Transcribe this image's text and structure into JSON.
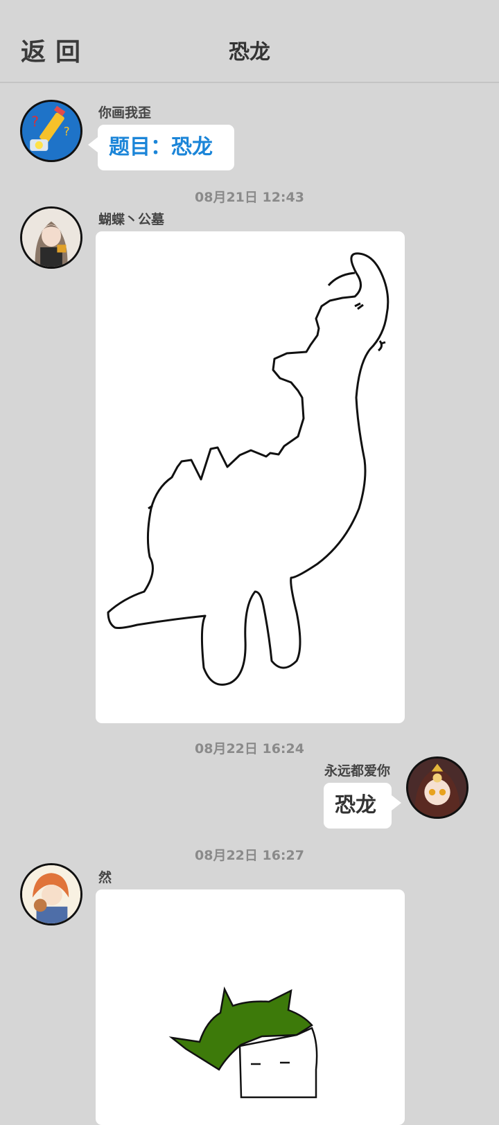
{
  "header": {
    "back_label": "返回",
    "title": "恐龙"
  },
  "messages": [
    {
      "sender": "你画我歪",
      "text": "题目：恐龙",
      "text_color": "#1b85d8"
    },
    {
      "time": "08月21日  12:43",
      "sender": "蝴蝶丶公墓",
      "content": "drawing-dinosaur"
    },
    {
      "time": "08月22日  16:24",
      "sender": "永远都爱你",
      "text": "恐龙"
    },
    {
      "time": "08月22日  16:27",
      "sender": "然",
      "content": "drawing-green-character"
    }
  ],
  "colors": {
    "background": "#d6d6d6",
    "bubble": "#ffffff",
    "accent": "#1b85d8",
    "drawing_green": "#3d7a0a"
  }
}
